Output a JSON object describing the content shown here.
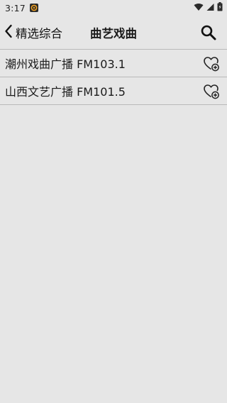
{
  "status": {
    "time": "3:17",
    "icons": [
      "app-notification-icon",
      "wifi-icon",
      "cellular-signal-icon",
      "battery-icon"
    ]
  },
  "header": {
    "back_label": "精选综合",
    "title": "曲艺戏曲",
    "search_icon": "search-icon"
  },
  "stations": [
    {
      "label": "潮州戏曲广播 FM103.1",
      "action_icon": "favorite-add-icon"
    },
    {
      "label": "山西文艺广播 FM101.5",
      "action_icon": "favorite-add-icon"
    }
  ],
  "colors": {
    "background": "#e6e6e6",
    "divider": "#b9b9b9",
    "text": "#1a1a1a"
  }
}
